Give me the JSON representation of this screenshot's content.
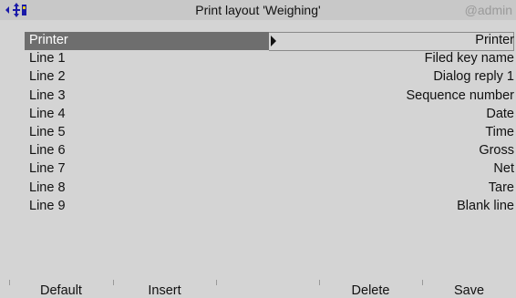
{
  "header": {
    "title": "Print layout 'Weighing'",
    "user": "@admin",
    "nav_icon": "navigate-icon"
  },
  "rows": [
    {
      "label": "Printer",
      "value": "Printer",
      "selected": true
    },
    {
      "label": "Line 1",
      "value": "Filed key name"
    },
    {
      "label": "Line 2",
      "value": "Dialog reply 1"
    },
    {
      "label": "Line 3",
      "value": "Sequence number"
    },
    {
      "label": "Line 4",
      "value": "Date"
    },
    {
      "label": "Line 5",
      "value": "Time"
    },
    {
      "label": "Line 6",
      "value": "Gross"
    },
    {
      "label": "Line 7",
      "value": "Net"
    },
    {
      "label": "Line 8",
      "value": "Tare"
    },
    {
      "label": "Line 9",
      "value": "Blank line"
    }
  ],
  "softkeys": {
    "f1": "Default",
    "f2": "Insert",
    "f3": "",
    "f4": "Delete",
    "f5": "Save"
  }
}
